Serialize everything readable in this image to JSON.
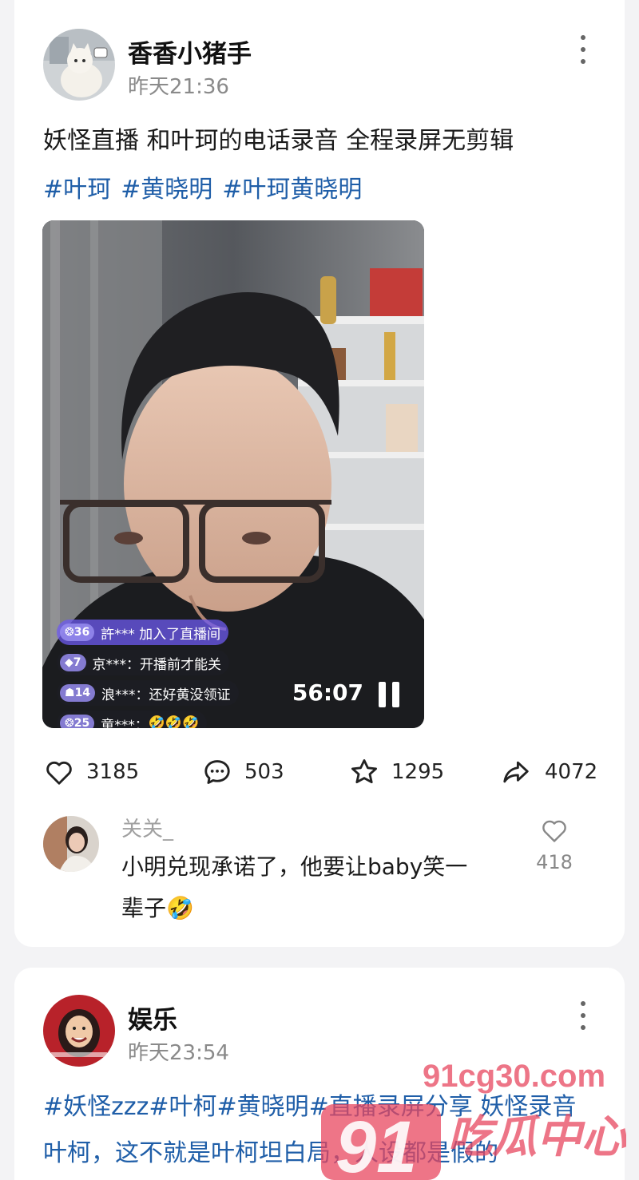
{
  "posts": [
    {
      "author": "香香小猪手",
      "time": "昨天21:36",
      "text": "妖怪直播 和叶珂的电话录音 全程录屏无剪辑",
      "tags": [
        "#叶珂",
        "#黄晓明",
        "#叶珂黄晓明"
      ],
      "video": {
        "duration": "56:07",
        "chat": [
          {
            "level": "36",
            "user": "許***",
            "message": "加入了直播间"
          },
          {
            "level": "7",
            "user": "京***",
            "message": "开播前才能关"
          },
          {
            "level": "14",
            "user": "浪***",
            "message": "还好黄没领证"
          },
          {
            "level": "25",
            "user": "童***",
            "message": "🤣🤣🤣"
          }
        ]
      },
      "stats": {
        "likes": "3185",
        "comments": "503",
        "favorites": "1295",
        "shares": "4072"
      },
      "top_comment": {
        "user": "关关_",
        "text": "小明兑现承诺了，他要让baby笑一辈子🤣",
        "likes": "418"
      }
    },
    {
      "author": "娱乐",
      "time": "昨天23:54",
      "text": "#妖怪zzz#叶柯#黄晓明#直播录屏分享 妖怪录音叶柯，这不就是叶柯坦白局，人设都是假的"
    }
  ],
  "watermark": {
    "domain": "91cg30.com",
    "logo": "91",
    "brand": "吃瓜中心"
  },
  "colors": {
    "tag": "#1f5ea8",
    "watermark": "#e8475f",
    "background": "#f3f3f5"
  }
}
